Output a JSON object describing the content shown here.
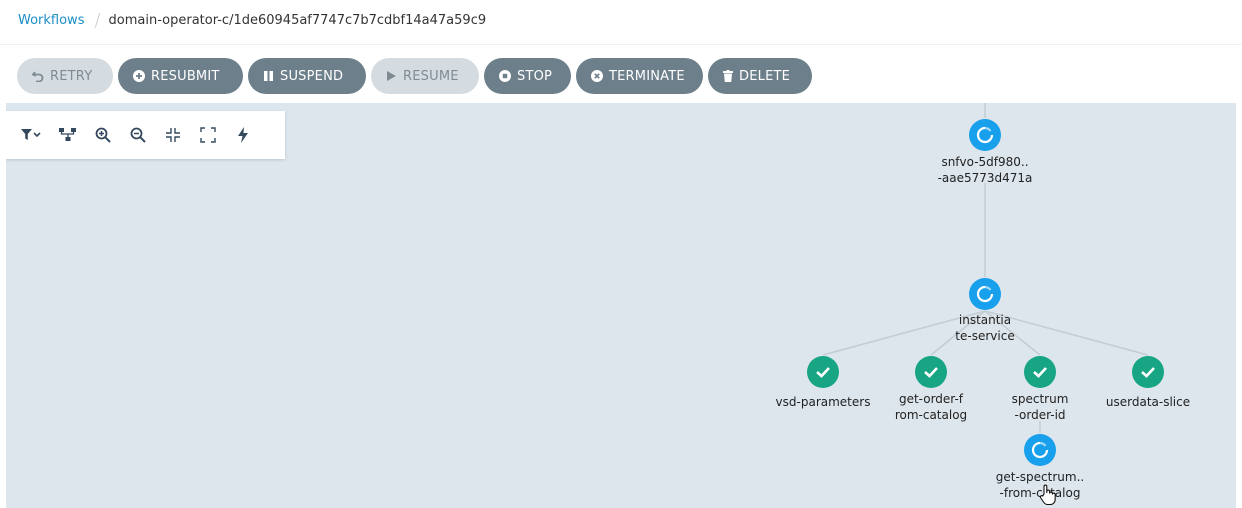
{
  "breadcrumb": {
    "root": "Workflows",
    "current": "domain-operator-c/1de60945af7747c7b7cdbf14a47a59c9"
  },
  "toolbar": {
    "buttons": [
      {
        "label": "RETRY",
        "icon": "undo-icon",
        "enabled": false
      },
      {
        "label": "RESUBMIT",
        "icon": "plus-circle-icon",
        "enabled": true
      },
      {
        "label": "SUSPEND",
        "icon": "pause-icon",
        "enabled": true
      },
      {
        "label": "RESUME",
        "icon": "play-icon",
        "enabled": false
      },
      {
        "label": "STOP",
        "icon": "stop-circle-icon",
        "enabled": true
      },
      {
        "label": "TERMINATE",
        "icon": "times-circle-icon",
        "enabled": true
      },
      {
        "label": "DELETE",
        "icon": "trash-icon",
        "enabled": true
      }
    ]
  },
  "graph_panel": {
    "tools": [
      "filter-icon",
      "hierarchy-icon",
      "zoom-in-icon",
      "zoom-out-icon",
      "collapse-icon",
      "expand-icon",
      "bolt-icon"
    ]
  },
  "nodes": {
    "snfvo": {
      "label": "snfvo-5df980..\n-aae5773d471a",
      "status": "running"
    },
    "instantiate": {
      "label": "instantia\nte-service",
      "status": "running"
    },
    "vsd": {
      "label": "vsd-parameters",
      "status": "succeeded"
    },
    "get_order": {
      "label": "get-order-f\nrom-catalog",
      "status": "succeeded"
    },
    "spectrum_order": {
      "label": "spectrum\n-order-id",
      "status": "succeeded"
    },
    "userdata": {
      "label": "userdata-slice",
      "status": "succeeded"
    },
    "get_spectrum": {
      "label": "get-spectrum..\n-from-catalog",
      "status": "running"
    }
  },
  "colors": {
    "running": "#18a0ec",
    "succeeded": "#17a584",
    "button": "#6d7f8b",
    "button_disabled": "#d5dce1",
    "canvas": "#dde6ed",
    "link": "#1a8fc7"
  }
}
